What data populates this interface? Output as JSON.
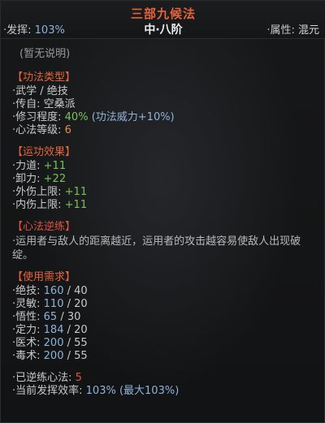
{
  "header": {
    "title": "三部九候法",
    "effect_label": "·发挥:",
    "effect_value": "103%",
    "grade": "中·八阶",
    "attribute_label": "·属性:",
    "attribute_value": "混元"
  },
  "description": "(暂无说明)",
  "sections": {
    "type": {
      "title": "【功法类型】",
      "rows": {
        "category": "·武学 / 绝技",
        "origin": "·传自: 空桑派",
        "mastery_label": "·修习程度:",
        "mastery_value": "40%",
        "mastery_note": "(功法威力+10%)",
        "level_label": "·心法等级:",
        "level_value": "6"
      }
    },
    "effects": {
      "title": "【运功效果】",
      "rows": [
        {
          "label": "·力道:",
          "value": "+11"
        },
        {
          "label": "·卸力:",
          "value": "+22"
        },
        {
          "label": "·外伤上限:",
          "value": "+11"
        },
        {
          "label": "·内伤上限:",
          "value": "+11"
        }
      ]
    },
    "reverse": {
      "title": "【心法逆练】",
      "text": "·运用者与敌人的距离越近，运用者的攻击越容易使敌人出现破绽。"
    },
    "requirements": {
      "title": "【使用需求】",
      "rows": [
        {
          "label": "·绝技:",
          "current": "160",
          "required": "/ 40"
        },
        {
          "label": "·灵敏:",
          "current": "110",
          "required": "/ 20"
        },
        {
          "label": "·悟性:",
          "current": "65",
          "required": "/ 30"
        },
        {
          "label": "·定力:",
          "current": "184",
          "required": "/ 20"
        },
        {
          "label": "·医术:",
          "current": "200",
          "required": "/ 55"
        },
        {
          "label": "·毒术:",
          "current": "200",
          "required": "/ 55"
        }
      ]
    },
    "footer": {
      "reversed_label": "·已逆练心法:",
      "reversed_value": "5",
      "efficiency_label": "·当前发挥效率:",
      "efficiency_value": "103%",
      "efficiency_note": "(最大103%)"
    }
  },
  "colors": {
    "accent": "#e5643b",
    "blue": "#8fb3d9",
    "green": "#79c35a",
    "orange": "#e58a4d",
    "background": "#141516"
  }
}
